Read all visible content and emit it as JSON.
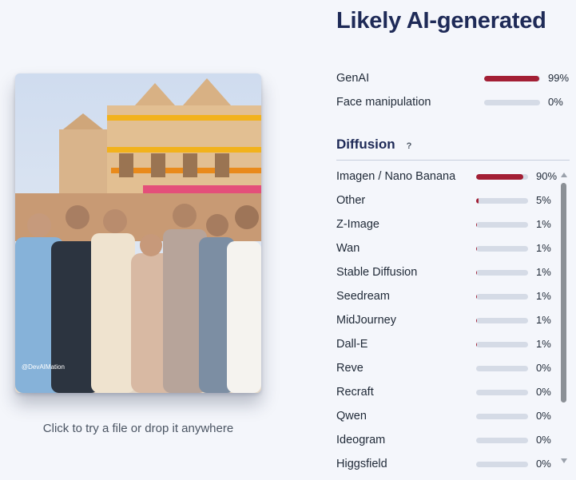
{
  "verdict": {
    "title": "Likely AI-generated"
  },
  "upload": {
    "hint": "Click to try a file or drop it anywhere",
    "watermark": "@DevAIMation"
  },
  "summary": [
    {
      "label": "GenAI",
      "percent_text": "99%",
      "value": 0.99
    },
    {
      "label": "Face manipulation",
      "percent_text": "0%",
      "value": 0.0
    }
  ],
  "diffusion": {
    "title": "Diffusion",
    "help_icon": "?",
    "items": [
      {
        "label": "Imagen / Nano Banana",
        "percent_text": "90%",
        "value": 0.9
      },
      {
        "label": "Other",
        "percent_text": "5%",
        "value": 0.05
      },
      {
        "label": "Z-Image",
        "percent_text": "1%",
        "value": 0.01
      },
      {
        "label": "Wan",
        "percent_text": "1%",
        "value": 0.01
      },
      {
        "label": "Stable Diffusion",
        "percent_text": "1%",
        "value": 0.01
      },
      {
        "label": "Seedream",
        "percent_text": "1%",
        "value": 0.01
      },
      {
        "label": "MidJourney",
        "percent_text": "1%",
        "value": 0.01
      },
      {
        "label": "Dall-E",
        "percent_text": "1%",
        "value": 0.01
      },
      {
        "label": "Reve",
        "percent_text": "0%",
        "value": 0.0
      },
      {
        "label": "Recraft",
        "percent_text": "0%",
        "value": 0.0
      },
      {
        "label": "Qwen",
        "percent_text": "0%",
        "value": 0.0
      },
      {
        "label": "Ideogram",
        "percent_text": "0%",
        "value": 0.0
      },
      {
        "label": "Higgsfield",
        "percent_text": "0%",
        "value": 0.0
      }
    ]
  },
  "colors": {
    "accent_bar": "#a31f35",
    "track": "#d5dbe6",
    "heading": "#1e2a57",
    "background": "#f4f6fb"
  },
  "icons": {
    "help": "question-mark-icon",
    "scroll_up": "chevron-up-icon",
    "scroll_down": "chevron-down-icon"
  }
}
